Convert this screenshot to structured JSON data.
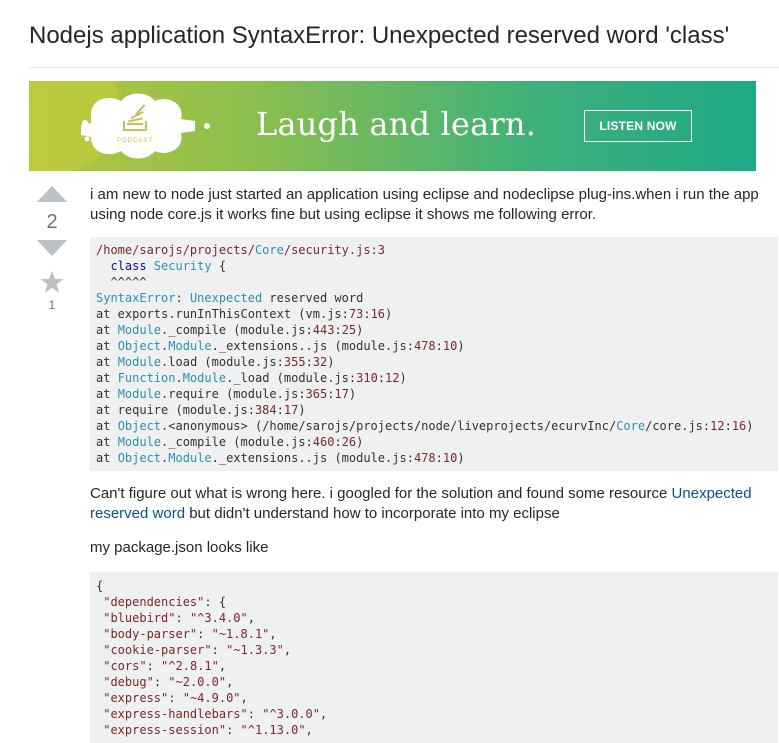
{
  "question": {
    "title": "Nodejs application SyntaxError: Unexpected reserved word 'class'",
    "votes": "2",
    "favorites": "1"
  },
  "banner": {
    "badge_text": "PODCAST",
    "headline": "Laugh and learn.",
    "cta_label": "LISTEN NOW"
  },
  "post": {
    "intro": "i am new to node just started an application using eclipse and nodeclipse plug-ins.when i run the app using node core.js it works fine but using eclipse it shows me following error.",
    "paragraph2_before": "Can't figure out what is wrong here. i googled for the solution and found some resource ",
    "paragraph2_link": "Unexpected reserved word",
    "paragraph2_after": " but didn't understand how to incorporate into my eclipse",
    "paragraph3": "my package.json looks like"
  },
  "error_trace": [
    [
      [
        "s",
        "/home/sarojs/projects/"
      ],
      [
        "t",
        "Core"
      ],
      [
        "s",
        "/security.js:3"
      ]
    ],
    [
      [
        "p",
        "  "
      ],
      [
        "k",
        "class"
      ],
      [
        "p",
        " "
      ],
      [
        "t",
        "Security"
      ],
      [
        "p",
        " {"
      ]
    ],
    [
      [
        "p",
        "  ^^^^^"
      ]
    ],
    [
      [
        "t",
        "SyntaxError"
      ],
      [
        "p",
        ": "
      ],
      [
        "t",
        "Unexpected"
      ],
      [
        "p",
        " reserved word"
      ]
    ],
    [
      [
        "p",
        "at exports.runInThisContext (vm.js:"
      ],
      [
        "s",
        "73"
      ],
      [
        "p",
        ":"
      ],
      [
        "s",
        "16"
      ],
      [
        "p",
        ")"
      ]
    ],
    [
      [
        "p",
        "at "
      ],
      [
        "t",
        "Module"
      ],
      [
        "p",
        "._compile (module.js:"
      ],
      [
        "s",
        "443"
      ],
      [
        "p",
        ":"
      ],
      [
        "s",
        "25"
      ],
      [
        "p",
        ")"
      ]
    ],
    [
      [
        "p",
        "at "
      ],
      [
        "t",
        "Object"
      ],
      [
        "p",
        "."
      ],
      [
        "t",
        "Module"
      ],
      [
        "p",
        "._extensions..js (module.js:"
      ],
      [
        "s",
        "478"
      ],
      [
        "p",
        ":"
      ],
      [
        "s",
        "10"
      ],
      [
        "p",
        ")"
      ]
    ],
    [
      [
        "p",
        "at "
      ],
      [
        "t",
        "Module"
      ],
      [
        "p",
        ".load (module.js:"
      ],
      [
        "s",
        "355"
      ],
      [
        "p",
        ":"
      ],
      [
        "s",
        "32"
      ],
      [
        "p",
        ")"
      ]
    ],
    [
      [
        "p",
        "at "
      ],
      [
        "t",
        "Function"
      ],
      [
        "p",
        "."
      ],
      [
        "t",
        "Module"
      ],
      [
        "p",
        "._load (module.js:"
      ],
      [
        "s",
        "310"
      ],
      [
        "p",
        ":"
      ],
      [
        "s",
        "12"
      ],
      [
        "p",
        ")"
      ]
    ],
    [
      [
        "p",
        "at "
      ],
      [
        "t",
        "Module"
      ],
      [
        "p",
        ".require (module.js:"
      ],
      [
        "s",
        "365"
      ],
      [
        "p",
        ":"
      ],
      [
        "s",
        "17"
      ],
      [
        "p",
        ")"
      ]
    ],
    [
      [
        "p",
        "at require (module.js:"
      ],
      [
        "s",
        "384"
      ],
      [
        "p",
        ":"
      ],
      [
        "s",
        "17"
      ],
      [
        "p",
        ")"
      ]
    ],
    [
      [
        "p",
        "at "
      ],
      [
        "t",
        "Object"
      ],
      [
        "p",
        ".<anonymous> (/home/sarojs/projects/node/liveprojects/ecurvInc/"
      ],
      [
        "t",
        "Core"
      ],
      [
        "p",
        "/core.js:"
      ],
      [
        "s",
        "12"
      ],
      [
        "p",
        ":"
      ],
      [
        "s",
        "16"
      ],
      [
        "p",
        ")"
      ]
    ],
    [
      [
        "p",
        "at "
      ],
      [
        "t",
        "Module"
      ],
      [
        "p",
        "._compile (module.js:"
      ],
      [
        "s",
        "460"
      ],
      [
        "p",
        ":"
      ],
      [
        "s",
        "26"
      ],
      [
        "p",
        ")"
      ]
    ],
    [
      [
        "p",
        "at "
      ],
      [
        "t",
        "Object"
      ],
      [
        "p",
        "."
      ],
      [
        "t",
        "Module"
      ],
      [
        "p",
        "._extensions..js (module.js:"
      ],
      [
        "s",
        "478"
      ],
      [
        "p",
        ":"
      ],
      [
        "s",
        "10"
      ],
      [
        "p",
        ")"
      ]
    ]
  ],
  "package_json": [
    [
      [
        "p",
        "{"
      ]
    ],
    [
      [
        "p",
        " "
      ],
      [
        "s",
        "\"dependencies\""
      ],
      [
        "p",
        ": {"
      ]
    ],
    [
      [
        "p",
        " "
      ],
      [
        "s",
        "\"bluebird\""
      ],
      [
        "p",
        ": "
      ],
      [
        "s",
        "\"^3.4.0\""
      ],
      [
        "p",
        ","
      ]
    ],
    [
      [
        "p",
        " "
      ],
      [
        "s",
        "\"body-parser\""
      ],
      [
        "p",
        ": "
      ],
      [
        "s",
        "\"~1.8.1\""
      ],
      [
        "p",
        ","
      ]
    ],
    [
      [
        "p",
        " "
      ],
      [
        "s",
        "\"cookie-parser\""
      ],
      [
        "p",
        ": "
      ],
      [
        "s",
        "\"~1.3.3\""
      ],
      [
        "p",
        ","
      ]
    ],
    [
      [
        "p",
        " "
      ],
      [
        "s",
        "\"cors\""
      ],
      [
        "p",
        ": "
      ],
      [
        "s",
        "\"^2.8.1\""
      ],
      [
        "p",
        ","
      ]
    ],
    [
      [
        "p",
        " "
      ],
      [
        "s",
        "\"debug\""
      ],
      [
        "p",
        ": "
      ],
      [
        "s",
        "\"~2.0.0\""
      ],
      [
        "p",
        ","
      ]
    ],
    [
      [
        "p",
        " "
      ],
      [
        "s",
        "\"express\""
      ],
      [
        "p",
        ": "
      ],
      [
        "s",
        "\"~4.9.0\""
      ],
      [
        "p",
        ","
      ]
    ],
    [
      [
        "p",
        " "
      ],
      [
        "s",
        "\"express-handlebars\""
      ],
      [
        "p",
        ": "
      ],
      [
        "s",
        "\"^3.0.0\""
      ],
      [
        "p",
        ","
      ]
    ],
    [
      [
        "p",
        " "
      ],
      [
        "s",
        "\"express-session\""
      ],
      [
        "p",
        ": "
      ],
      [
        "s",
        "\"^1.13.0\""
      ],
      [
        "p",
        ","
      ]
    ]
  ],
  "colors": {
    "link": "#0c4d8c",
    "code_bg": "#eff0f1",
    "vote_icon": "#bbc0c4",
    "banner_start": "#b6c63f",
    "banner_end": "#1ea987"
  },
  "icons": [
    "upvote-arrow-icon",
    "downvote-arrow-icon",
    "favorite-star-icon",
    "stack-overflow-podcast-logo"
  ]
}
